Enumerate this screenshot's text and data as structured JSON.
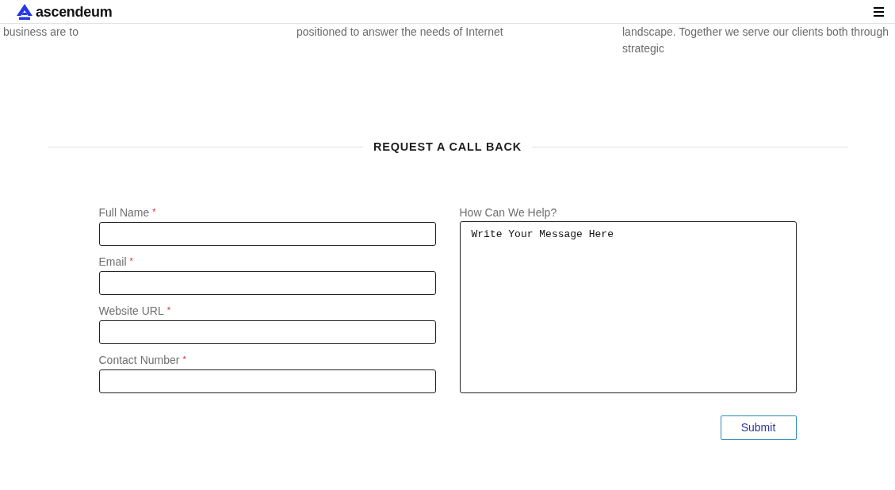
{
  "header": {
    "logo_text": "ascendeum"
  },
  "intro_columns": [
    {
      "lines": [
        "business are to"
      ]
    },
    {
      "lines": [
        "positioned to answer the needs of Internet"
      ]
    },
    {
      "lines": [
        "landscape. Together we serve our clients both through",
        "strategic"
      ]
    }
  ],
  "callback_form": {
    "title": "REQUEST A CALL BACK",
    "fields": [
      {
        "label": "Full Name",
        "required_mark": "*"
      },
      {
        "label": "Email",
        "required_mark": "*"
      },
      {
        "label": "Website URL",
        "required_mark": "*"
      },
      {
        "label": "Contact Number",
        "required_mark": "*"
      }
    ],
    "message": {
      "label": "How Can We Help?",
      "placeholder": "Write Your Message Here"
    },
    "submit": "Submit"
  }
}
